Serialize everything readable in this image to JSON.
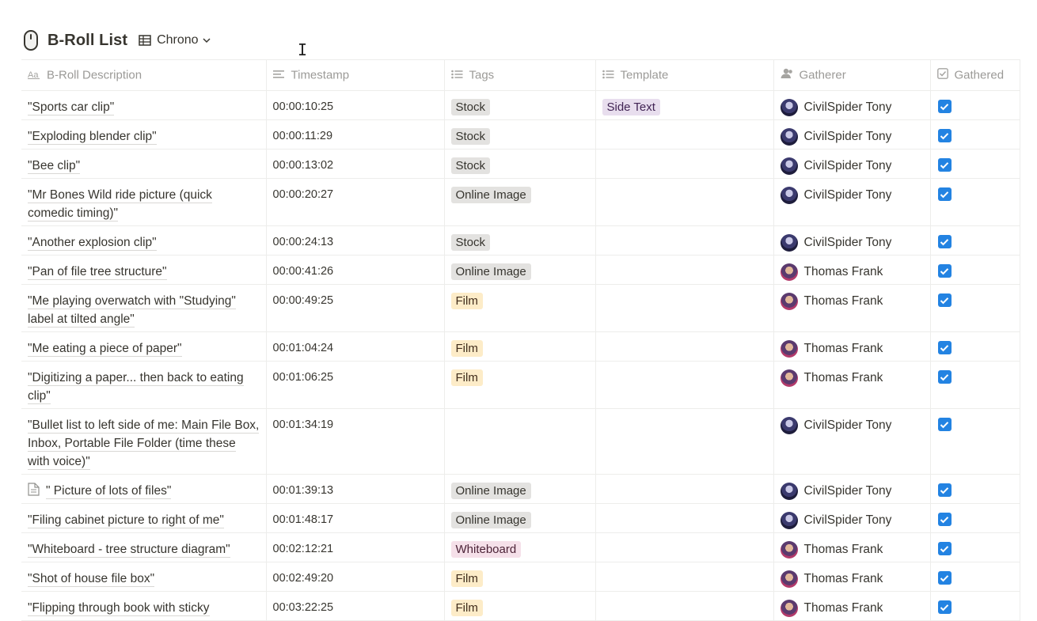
{
  "database": {
    "title": "B-Roll List",
    "icon": "computer-mouse-icon",
    "view_label": "Chrono"
  },
  "columns": [
    {
      "key": "description",
      "label": "B-Roll Description",
      "icon": "text-type-icon"
    },
    {
      "key": "timestamp",
      "label": "Timestamp",
      "icon": "text-lines-icon"
    },
    {
      "key": "tags",
      "label": "Tags",
      "icon": "list-icon"
    },
    {
      "key": "template",
      "label": "Template",
      "icon": "list-icon"
    },
    {
      "key": "gatherer",
      "label": "Gatherer",
      "icon": "person-icon"
    },
    {
      "key": "gathered",
      "label": "Gathered",
      "icon": "checkbox-icon"
    }
  ],
  "tag_colors": {
    "Stock": {
      "bg": "#e3e2e0",
      "fg": "#37352f"
    },
    "Online Image": {
      "bg": "#e3e2e0",
      "fg": "#37352f"
    },
    "Film": {
      "bg": "#fdecc8",
      "fg": "#402c1b"
    },
    "Whiteboard": {
      "bg": "#f5e0e9",
      "fg": "#4c2337"
    },
    "Side Text": {
      "bg": "#e8deee",
      "fg": "#412454"
    }
  },
  "rows": [
    {
      "description": "\"Sports car clip\"",
      "timestamp": "00:00:10:25",
      "tags": "Stock",
      "template": "Side Text",
      "gatherer": "CivilSpider Tony",
      "gathered": true
    },
    {
      "description": "\"Exploding blender clip\"",
      "timestamp": "00:00:11:29",
      "tags": "Stock",
      "template": "",
      "gatherer": "CivilSpider Tony",
      "gathered": true
    },
    {
      "description": "\"Bee clip\"",
      "timestamp": "00:00:13:02",
      "tags": "Stock",
      "template": "",
      "gatherer": "CivilSpider Tony",
      "gathered": true
    },
    {
      "description": "\"Mr Bones Wild ride picture (quick comedic timing)\"",
      "timestamp": "00:00:20:27",
      "tags": "Online Image",
      "template": "",
      "gatherer": "CivilSpider Tony",
      "gathered": true
    },
    {
      "description": "\"Another explosion clip\"",
      "timestamp": "00:00:24:13",
      "tags": "Stock",
      "template": "",
      "gatherer": "CivilSpider Tony",
      "gathered": true
    },
    {
      "description": "\"Pan of file tree structure\"",
      "timestamp": "00:00:41:26",
      "tags": "Online Image",
      "template": "",
      "gatherer": "Thomas Frank",
      "gathered": true
    },
    {
      "description": "\"Me playing overwatch with \"Studying\" label at tilted angle\"",
      "timestamp": "00:00:49:25",
      "tags": "Film",
      "template": "",
      "gatherer": "Thomas Frank",
      "gathered": true
    },
    {
      "description": "\"Me eating a piece of paper\"",
      "timestamp": "00:01:04:24",
      "tags": "Film",
      "template": "",
      "gatherer": "Thomas Frank",
      "gathered": true
    },
    {
      "description": "\"Digitizing a paper... then back to eating clip\"",
      "timestamp": "00:01:06:25",
      "tags": "Film",
      "template": "",
      "gatherer": "Thomas Frank",
      "gathered": true
    },
    {
      "description": "\"Bullet list to left side of me: Main File Box, Inbox, Portable File Folder (time these with voice)\"",
      "timestamp": "00:01:34:19",
      "tags": "",
      "template": "",
      "gatherer": "CivilSpider Tony",
      "gathered": true
    },
    {
      "description": "\" Picture of lots of files\"",
      "timestamp": "00:01:39:13",
      "tags": "Online Image",
      "template": "",
      "gatherer": "CivilSpider Tony",
      "gathered": true,
      "page_icon": "document-icon"
    },
    {
      "description": "\"Filing cabinet picture to right of me\"",
      "timestamp": "00:01:48:17",
      "tags": "Online Image",
      "template": "",
      "gatherer": "CivilSpider Tony",
      "gathered": true
    },
    {
      "description": "\"Whiteboard - tree structure diagram\"",
      "timestamp": "00:02:12:21",
      "tags": "Whiteboard",
      "template": "",
      "gatherer": "Thomas Frank",
      "gathered": true
    },
    {
      "description": "\"Shot of house file box\"",
      "timestamp": "00:02:49:20",
      "tags": "Film",
      "template": "",
      "gatherer": "Thomas Frank",
      "gathered": true
    },
    {
      "description": "\"Flipping through book with sticky",
      "timestamp": "00:03:22:25",
      "tags": "Film",
      "template": "",
      "gatherer": "Thomas Frank",
      "gathered": true
    }
  ]
}
